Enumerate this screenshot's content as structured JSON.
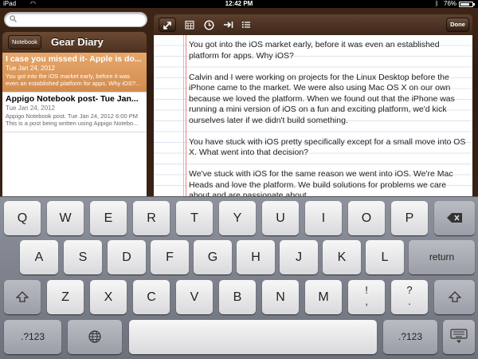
{
  "status": {
    "carrier": "iPad",
    "time": "12:42 PM",
    "battery": "76%",
    "battery_level": 0.76
  },
  "search": {
    "placeholder": ""
  },
  "list_header": {
    "notebook_button": "Notebook",
    "title": "Gear Diary"
  },
  "notes": [
    {
      "title": "I case you missed it- Apple is do...",
      "date": "Tue Jan 24, 2012",
      "preview": "You got into the iOS market early, before it was even an established platform for apps. Why iOS?...",
      "selected": true
    },
    {
      "title": "Appigo Notebook post- Tue Jan...",
      "date": "Tue Jan 24, 2012",
      "preview": "Appigo Notebook post. Tue Jan 24, 2012 6:00 PM  This is a post being written using Appigo Notebo...",
      "selected": false
    }
  ],
  "toolbar": {
    "expand_icon": "expand-icon",
    "calendar_icon": "calendar-icon",
    "clock_icon": "clock-icon",
    "indent_icon": "indent-icon",
    "list_icon": "list-icon",
    "done_label": "Done"
  },
  "note_body": [
    "You got into the iOS market early, before it was even an established platform for apps. Why iOS?",
    "Calvin and I were working on projects for the Linux Desktop before the iPhone came to the market.  We were also using Mac OS X on our own because we loved the platform.  When we found out that the iPhone was running a mini version of iOS on a fun and exciting platform, we'd kick ourselves later if we didn't build something.",
    "You have stuck with iOS pretty specifically except for a small move into OS X. What went into that decision?",
    "We've stuck with iOS for the same reason we went into iOS.  We're Mac Heads and love the platform.  We build solutions for problems we care about and are passionate about."
  ],
  "keyboard": {
    "row1": [
      "Q",
      "W",
      "E",
      "R",
      "T",
      "Y",
      "U",
      "I",
      "O",
      "P"
    ],
    "row2": [
      "A",
      "S",
      "D",
      "F",
      "G",
      "H",
      "J",
      "K",
      "L"
    ],
    "row3": [
      "Z",
      "X",
      "C",
      "V",
      "B",
      "N",
      "M"
    ],
    "return_label": "return",
    "numbers_label": ".?123",
    "excl_top": "!",
    "excl_bottom": ",",
    "q_top": "?",
    "q_bottom": ".",
    "backspace_icon": "backspace-icon",
    "shift_icon": "shift-icon",
    "globe_icon": "globe-icon",
    "hide_icon": "keyboard-hide-icon"
  }
}
